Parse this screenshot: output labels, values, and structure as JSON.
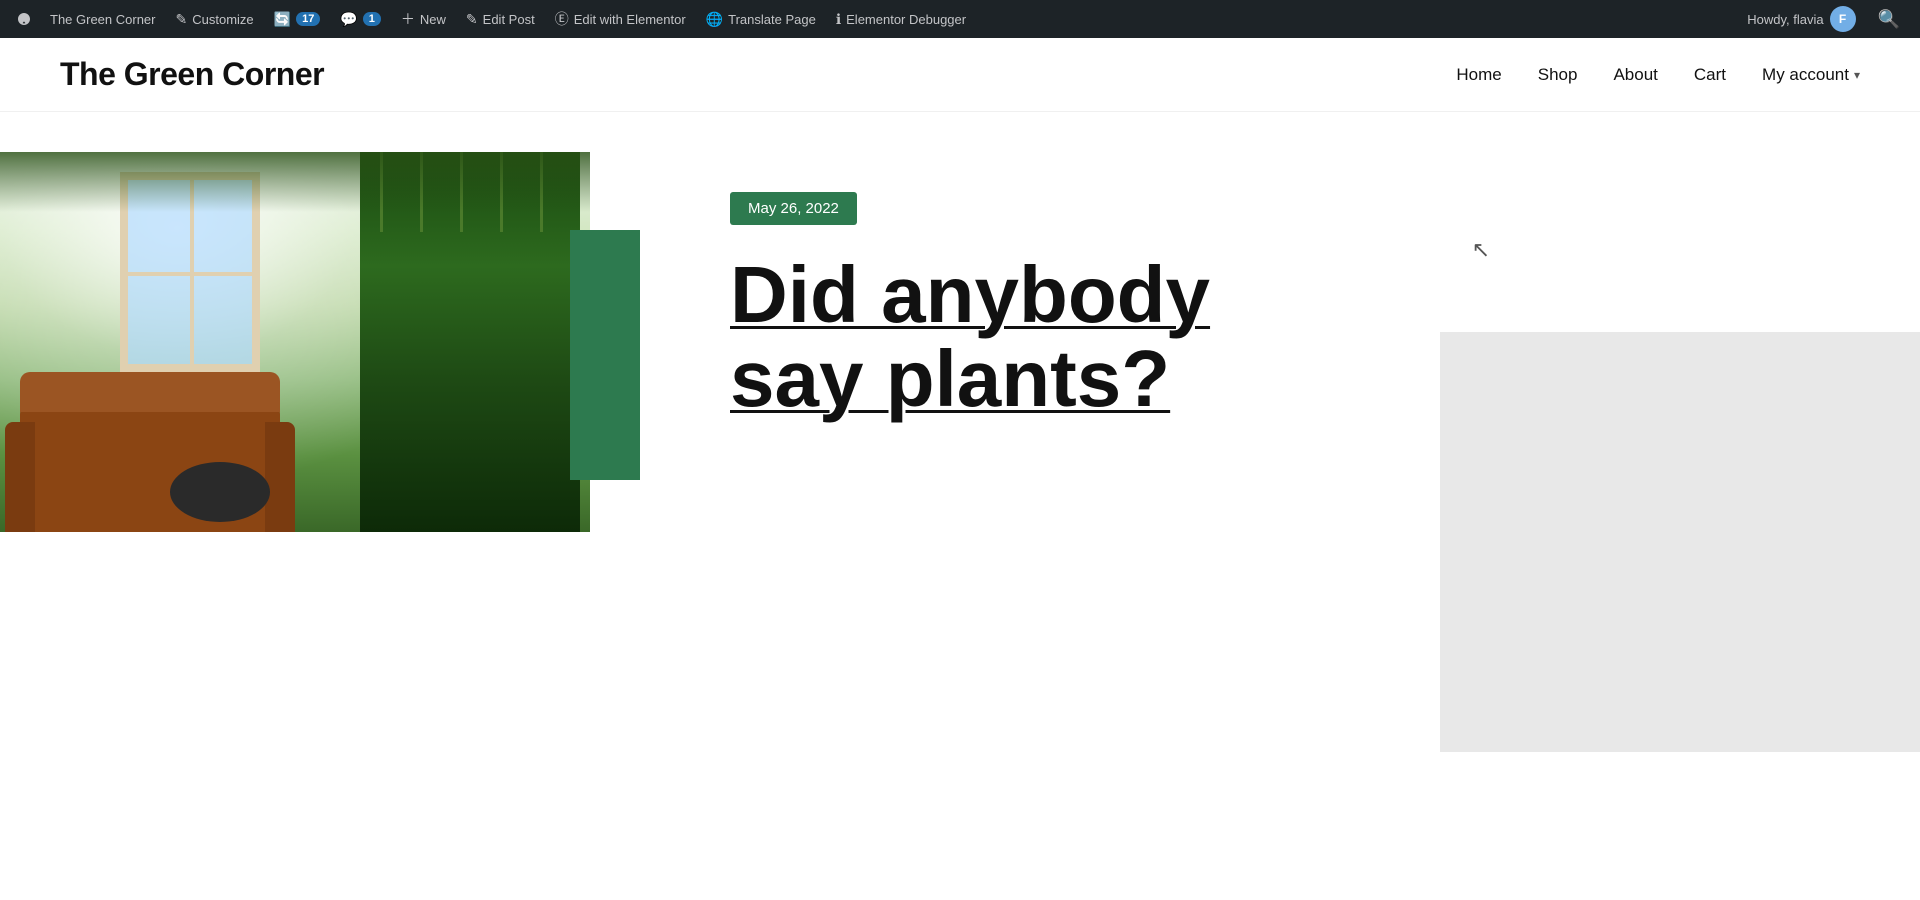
{
  "admin_bar": {
    "wp_label": "WordPress",
    "site_name": "The Green Corner",
    "customize_label": "Customize",
    "updates_label": "17",
    "comments_label": "1",
    "new_label": "New",
    "edit_post_label": "Edit Post",
    "edit_elementor_label": "Edit with Elementor",
    "translate_label": "Translate Page",
    "debugger_label": "Elementor Debugger",
    "howdy_label": "Howdy, flavia",
    "search_aria": "Search"
  },
  "header": {
    "site_title": "The Green Corner",
    "nav": {
      "home": "Home",
      "shop": "Shop",
      "about": "About",
      "cart": "Cart",
      "my_account": "My account"
    }
  },
  "hero": {
    "date_badge": "May 26, 2022",
    "post_title_line1": "Did anybody",
    "post_title_line2": "say plants?"
  },
  "colors": {
    "green_accent": "#2d7a4f",
    "admin_bar_bg": "#1d2327",
    "text_dark": "#111111",
    "gray_bg": "#e8e8e8"
  }
}
